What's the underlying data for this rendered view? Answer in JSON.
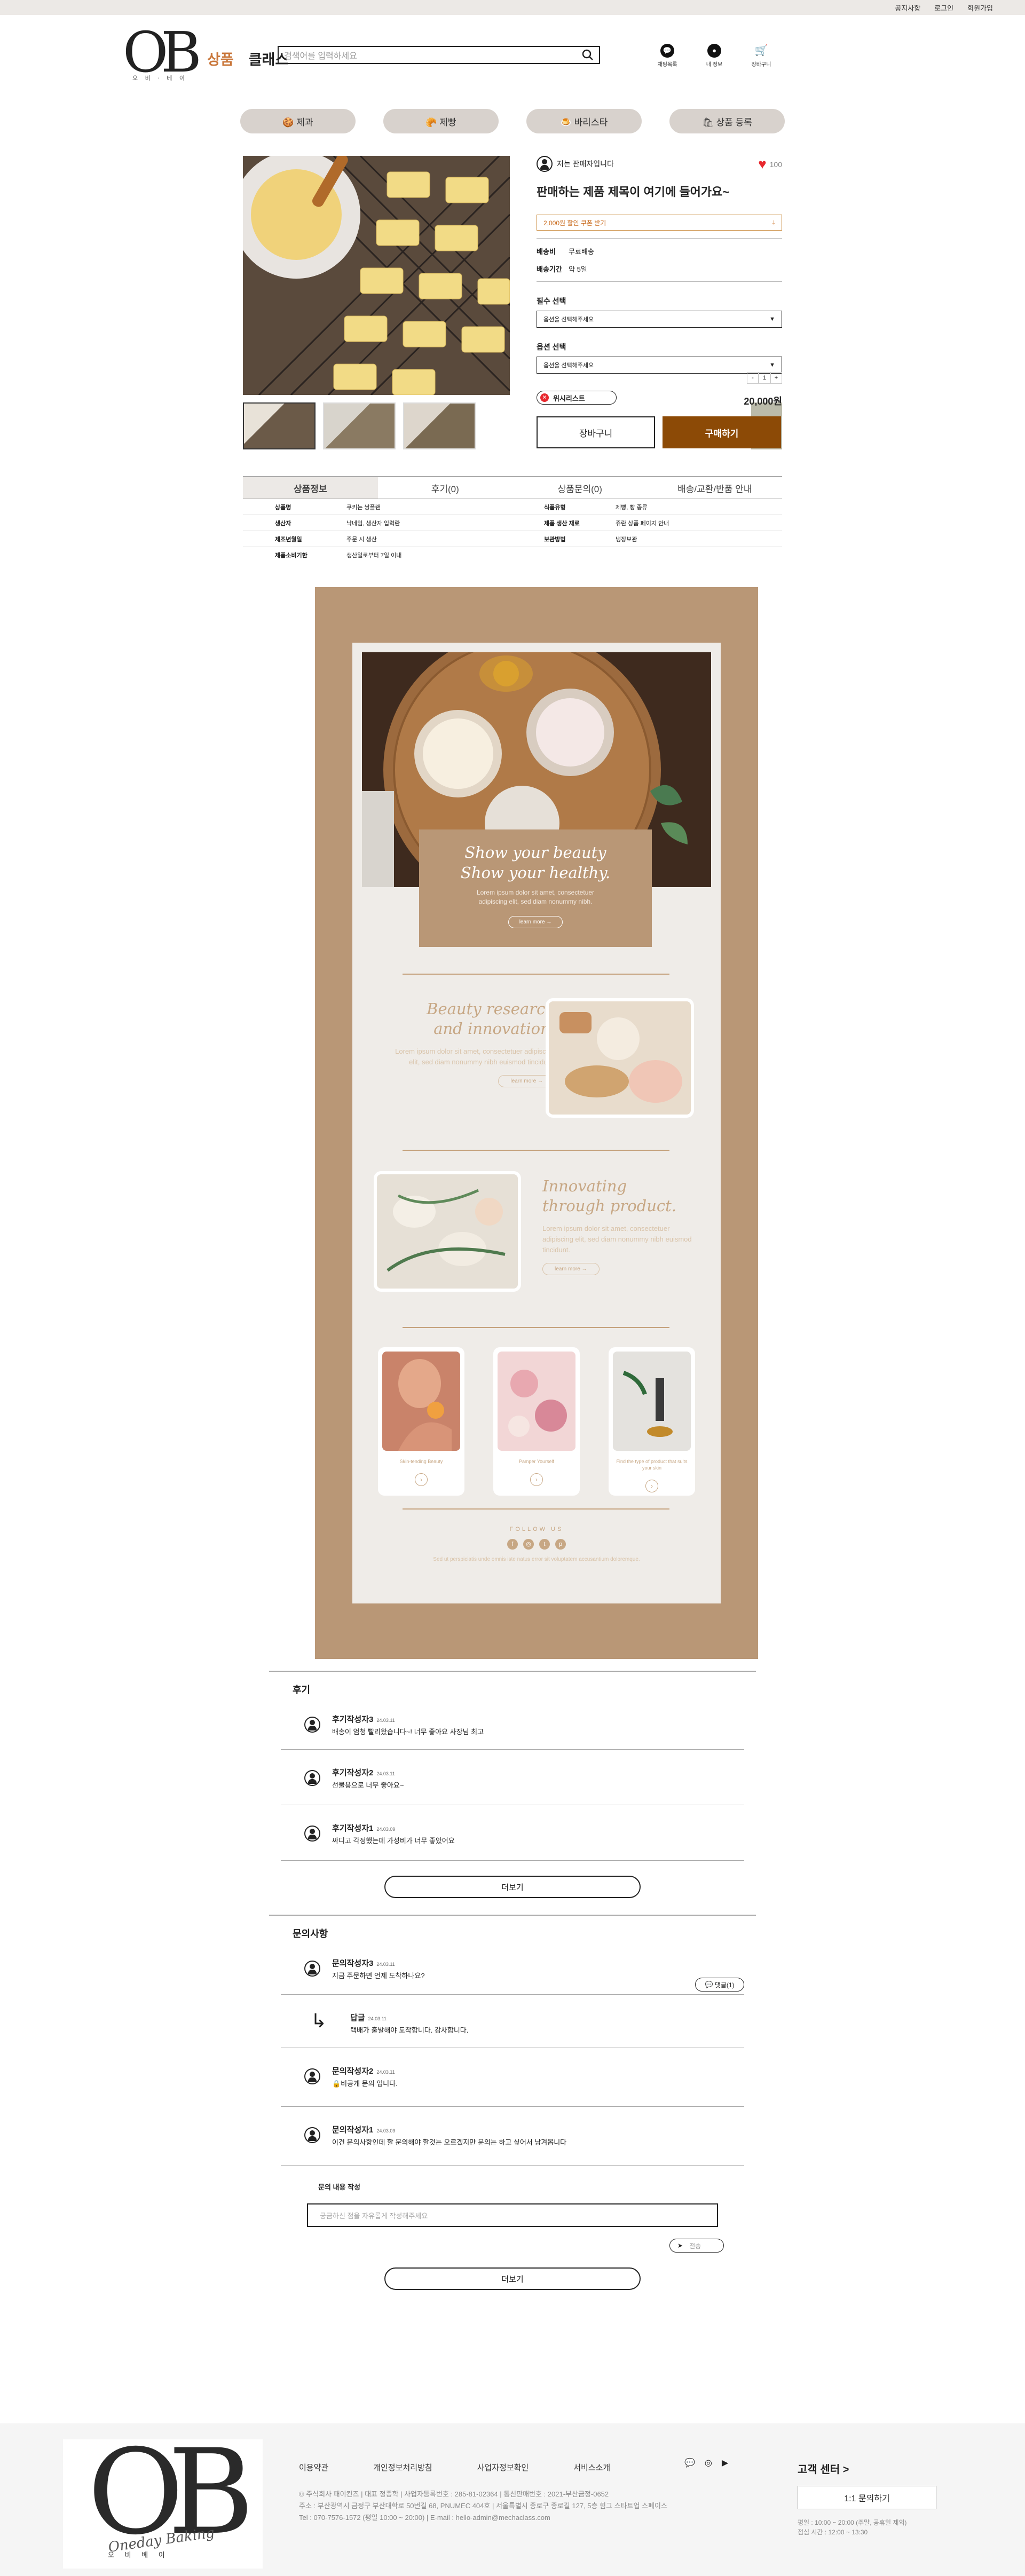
{
  "topbar": {
    "notice": "공지사항",
    "login": "로그인",
    "join": "회원가입"
  },
  "header": {
    "logo": "OB",
    "logo_sub": "오 비 · 베 이",
    "nav1": "상품",
    "nav2": "클래스",
    "search_placeholder": "검색어를 입력하세요",
    "icons": [
      {
        "name": "chat-icon",
        "label": "채팅목록"
      },
      {
        "name": "mypage-icon",
        "label": "내 정보"
      },
      {
        "name": "cart-icon",
        "label": "장바구니"
      }
    ]
  },
  "category_tabs": [
    "🍪 제과",
    "🥐 제빵",
    "🍮 바리스타",
    "🛍 상품 등록"
  ],
  "product": {
    "seller": "저는 판매자입니다",
    "likes": "100",
    "title": "판매하는 제품 제목이 여기에 들어가요~",
    "coupon": "2,000원 할인 쿠폰 받기",
    "ship_label": "배송비",
    "ship_value": "무료배송",
    "period_label": "배송기간",
    "period_value": "약 5일",
    "req_label": "필수 선택",
    "req_placeholder": "옵션을 선택해주세요",
    "opt_label": "옵션 선택",
    "opt_placeholder": "옵션을 선택해주세요",
    "qty": "1",
    "wish": "위시리스트",
    "price": "20,000원",
    "cart_btn": "장바구니",
    "buy_btn": "구매하기"
  },
  "detail_tabs": [
    "상품정보",
    "후기(0)",
    "상품문의(0)",
    "배송/교환/반품 안내"
  ],
  "spec": [
    [
      "상품명",
      "쿠키는 쌍플랜",
      "식품유형",
      "제빵, 빵 종류"
    ],
    [
      "생산자",
      "낙네임, 생산자 입력란",
      "제품 생산 재료",
      "쥬란 상품 페이지 안내"
    ],
    [
      "제조년월일",
      "주문 시 생산",
      "보관방법",
      "냉장보관"
    ],
    [
      "제품소비기한",
      "생산일로부터 7일 이내",
      "",
      ""
    ]
  ],
  "banner": {
    "hero_t1": "Show your beauty",
    "hero_t2": "Show your healthy.",
    "hero_txt": "Lorem ipsum dolor sit amet, consectetuer adipiscing elit, sed diam nonummy nibh.",
    "hero_btn": "learn more →",
    "s2_title1": "Beauty research",
    "s2_title2": "and innovation.",
    "s2_txt": "Lorem ipsum dolor sit amet, consectetuer adipiscing elit, sed diam nonummy nibh euismod tincidunt.",
    "s2_btn": "learn more →",
    "s3_title1": "Innovating",
    "s3_title2": "through product.",
    "s3_txt": "Lorem ipsum dolor sit amet, consectetuer adipiscing elit, sed diam nonummy nibh euismod tincidunt.",
    "s3_btn": "learn more →",
    "minis": [
      "Skin-tending Beauty",
      "Pamper Yourself",
      "Find the type of product that suits your skin"
    ],
    "follow": "FOLLOW US",
    "follow_txt": "Sed ut perspiciatis unde omnis iste natus error sit voluptatem accusantium doloremque."
  },
  "reviews": {
    "title": "후기",
    "items": [
      {
        "name": "후기작성자3",
        "date": "24.03.11",
        "text": "배송이 엄청 빨리왔습니다~! 너무 좋아요 사장님 최고"
      },
      {
        "name": "후기작성자2",
        "date": "24.03.11",
        "text": "선물용으로 너무 좋아요~"
      },
      {
        "name": "후기작성자1",
        "date": "24.03.09",
        "text": "싸디고 각정했는데 가성비가 너무 좋았어요"
      }
    ],
    "more": "더보기"
  },
  "qna": {
    "title": "문의사항",
    "items": [
      {
        "name": "문의작성자3",
        "date": "24.03.11",
        "text": "지금 주문하면 언제 도착하나요?",
        "reply": "댓글(1)"
      },
      {
        "name": "답글",
        "date": "24.03.11",
        "text": "택배가 출발해야 도착합니다. 감사합니다."
      },
      {
        "name": "문의작성자2",
        "date": "24.03.11",
        "text": "🔒비공개 문의 입니다."
      },
      {
        "name": "문의작성자1",
        "date": "24.03.09",
        "text": "이건 문의사항인데 할 문의해야 할것는 오르겠지만 문의는 하고 싶어서 남겨봅니다"
      }
    ],
    "write_label": "문의 내용 작성",
    "write_placeholder": "궁금하신 점을 자유롭게 작성해주세요",
    "send": "전송",
    "more": "더보기"
  },
  "footer": {
    "logo": "OB",
    "logo_script": "Oneday Baking",
    "logo_kr": "오 비 베 이",
    "links": [
      "이용약관",
      "개인정보처리방침",
      "사업자정보확인",
      "서비스소개"
    ],
    "info1": "© 주식회사 패이킨즈 | 대표 정종학 | 사업자등록번호 : 285-81-02364 | 통신판매번호 : 2021-부산금정-0652",
    "info2": "주소 : 부산광역시 금정구 부산대학로 50번길 68, PNUMEC 404호 | 서울특별시 종로구 종로길 127, 5층 힘그 스타트업 스페이스",
    "info3": "Tel : 070-7576-1572 (평일 10:00 ~ 20:00) | E-mail : hello-admin@mechaclass.com",
    "cs_title": "고객 센터 >",
    "cs_btn": "1:1 문의하기",
    "cs_time1": "평일 : 10:00 ~ 20:00 (주말, 공휴일 제외)",
    "cs_time2": "점심 시간 : 12:00 ~ 13:30"
  }
}
